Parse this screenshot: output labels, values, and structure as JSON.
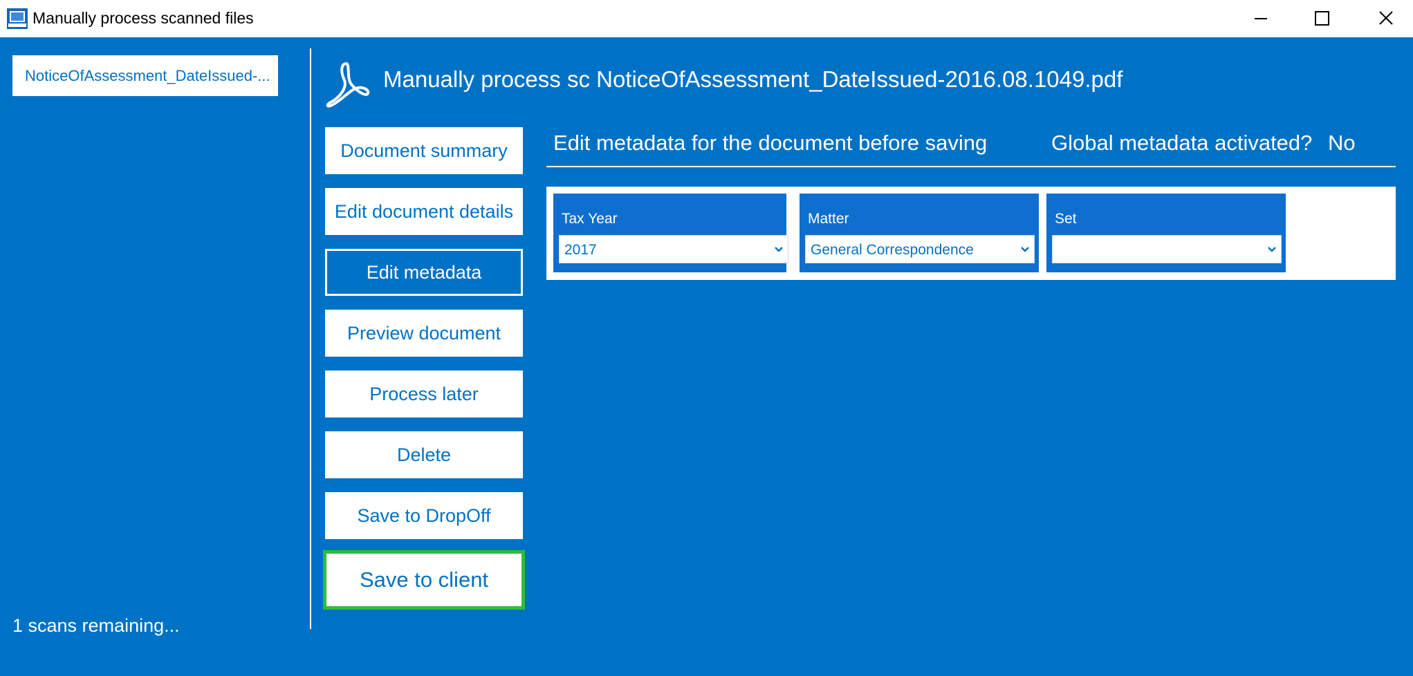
{
  "window": {
    "title": "Manually process scanned files",
    "controls": [
      "minimize-icon",
      "maximize-icon",
      "close-icon"
    ]
  },
  "sidebar": {
    "files": [
      {
        "label": "NoticeOfAssessment_DateIssued-..."
      }
    ],
    "status": "1 scans remaining..."
  },
  "header": {
    "icon": "pdf-icon",
    "title": "Manually process sc NoticeOfAssessment_DateIssued-2016.08.1049.pdf"
  },
  "nav": {
    "document_summary": "Document summary",
    "edit_document_details": "Edit document details",
    "edit_metadata": "Edit metadata",
    "preview_document": "Preview document",
    "process_later": "Process later",
    "delete": "Delete",
    "save_to_dropoff": "Save to DropOff",
    "save_to_client": "Save to client",
    "active": "Edit metadata"
  },
  "metadata": {
    "heading": "Edit metadata for the document before saving",
    "global_label": "Global metadata activated?",
    "global_value": "No",
    "fields": [
      {
        "label": "Tax Year",
        "value": "2017"
      },
      {
        "label": "Matter",
        "value": "General Correspondence"
      },
      {
        "label": "Set",
        "value": ""
      }
    ]
  },
  "colors": {
    "background": "#0072c6",
    "field_background": "#0e6fcf",
    "highlight_border": "#2ebd3a",
    "text_light": "#ffffff"
  }
}
